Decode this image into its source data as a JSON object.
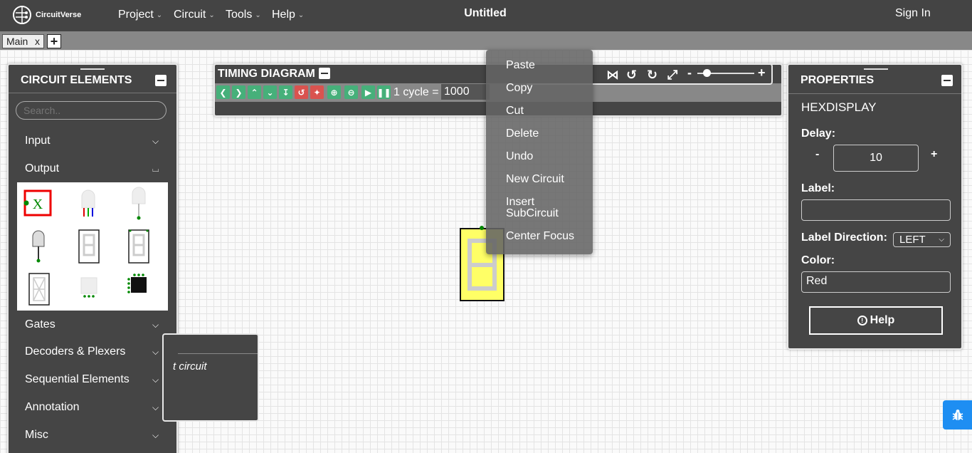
{
  "navbar": {
    "logo_text": "CircuitVerse",
    "menus": [
      "Project",
      "Circuit",
      "Tools",
      "Help"
    ],
    "title": "Untitled",
    "signin": "Sign In"
  },
  "tabs": {
    "main_label": "Main",
    "close": "x",
    "add": "+"
  },
  "elements_panel": {
    "title": "CIRCUIT ELEMENTS",
    "search_placeholder": "Search..",
    "categories": [
      "Input",
      "Output",
      "Gates",
      "Decoders & Plexers",
      "Sequential Elements",
      "Annotation",
      "Misc"
    ]
  },
  "timing": {
    "title": "TIMING DIAGRAM",
    "cycle_label": "1 cycle =",
    "cycle_value": "1000"
  },
  "context_menu": [
    "Paste",
    "Copy",
    "Cut",
    "Delete",
    "Undo",
    "New Circuit",
    "Insert SubCircuit",
    "Center Focus"
  ],
  "dialog": {
    "text": "t circuit"
  },
  "properties": {
    "title": "PROPERTIES",
    "element": "HEXDISPLAY",
    "delay_label": "Delay:",
    "delay_minus": "-",
    "delay_value": "10",
    "delay_plus": "+",
    "label_label": "Label:",
    "label_value": "",
    "direction_label": "Label Direction:",
    "direction_value": "LEFT",
    "color_label": "Color:",
    "color_value": "Red",
    "help": "Help"
  },
  "zoom": {
    "minus": "-",
    "plus": "+"
  }
}
